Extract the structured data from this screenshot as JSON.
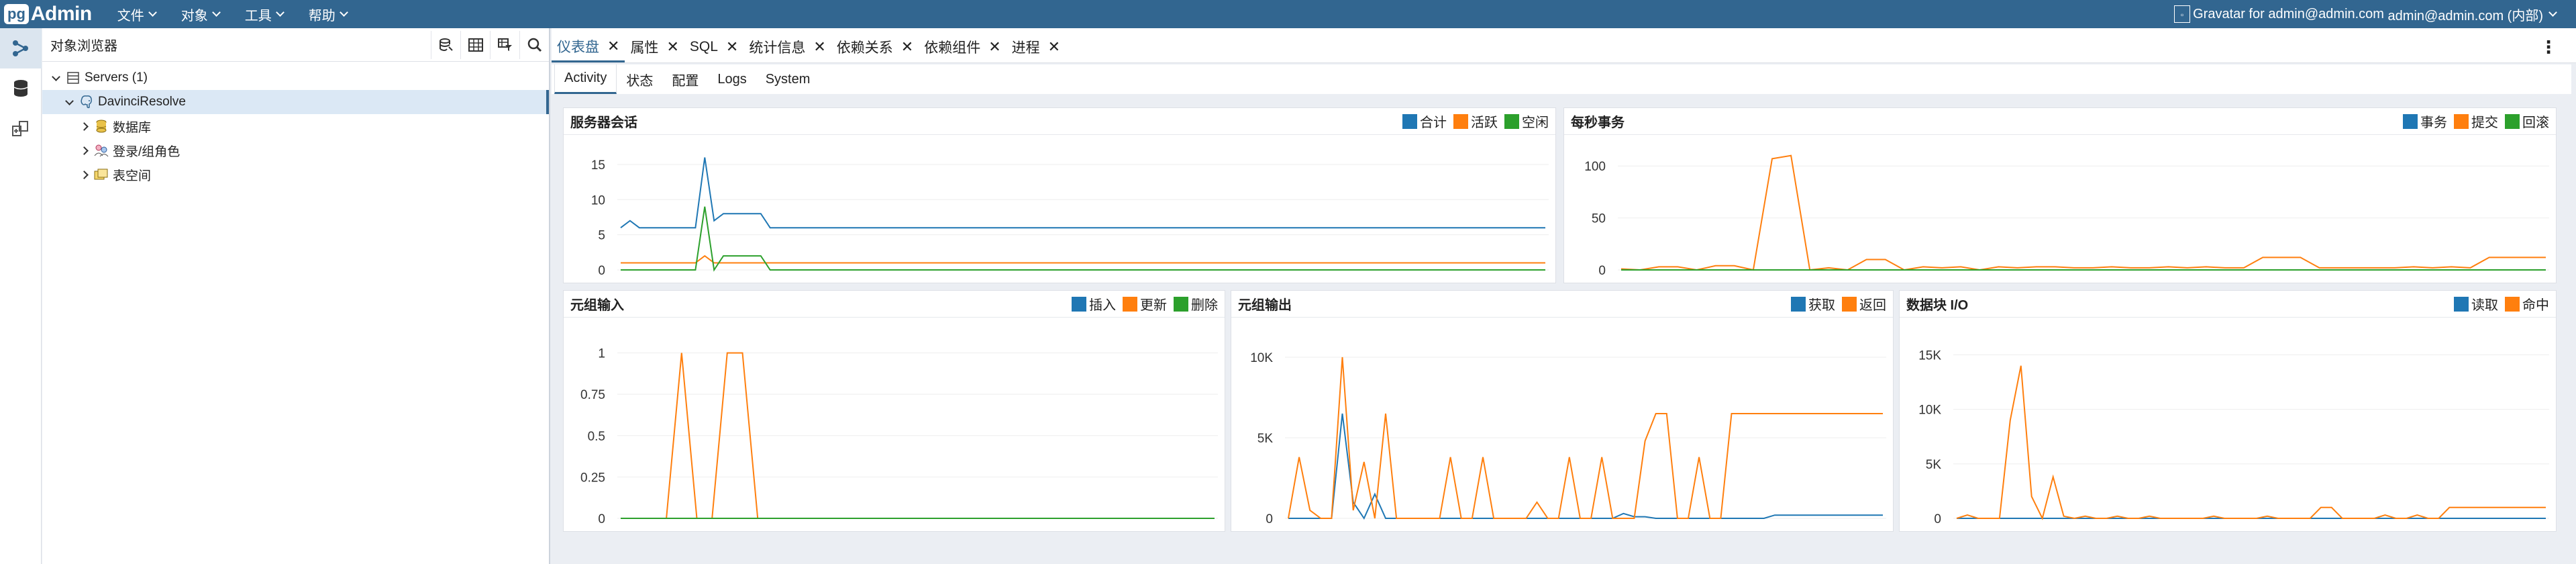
{
  "app": {
    "logo_pg": "pg",
    "logo_admin": "Admin"
  },
  "menu": [
    "文件",
    "对象",
    "工具",
    "帮助"
  ],
  "user": {
    "avatar_alt": "Gravatar for admin@admin.com",
    "label": "admin@admin.com (内部)"
  },
  "browser": {
    "title": "对象浏览器",
    "tree": [
      {
        "label": "Servers (1)",
        "level": 0,
        "expanded": true
      },
      {
        "label": "DavinciResolve",
        "level": 1,
        "expanded": true
      },
      {
        "label": "数据库",
        "level": 2
      },
      {
        "label": "登录/组角色",
        "level": 2
      },
      {
        "label": "表空间",
        "level": 2
      }
    ]
  },
  "tabs": [
    "仪表盘",
    "属性",
    "SQL",
    "统计信息",
    "依赖关系",
    "依赖组件",
    "进程"
  ],
  "subtabs": [
    "Activity",
    "状态",
    "配置",
    "Logs",
    "System"
  ],
  "colors": {
    "blue": "#1f77b4",
    "orange": "#ff7f0e",
    "green": "#2ca02c",
    "brand": "#326690"
  },
  "chart_data": [
    {
      "type": "line",
      "title": "服务器会话",
      "yticks": [
        "0",
        "5",
        "10",
        "15"
      ],
      "ylim": [
        0,
        17
      ],
      "series": [
        {
          "name": "合计",
          "color": "#1f77b4",
          "values": [
            6,
            7,
            6,
            6,
            6,
            6,
            6,
            6,
            6,
            16,
            7,
            8,
            8,
            8,
            8,
            8,
            6,
            6,
            6,
            6,
            6,
            6,
            6,
            6,
            6,
            6,
            6,
            6,
            6,
            6,
            6,
            6,
            6,
            6,
            6,
            6,
            6,
            6,
            6,
            6,
            6,
            6,
            6,
            6,
            6,
            6,
            6,
            6,
            6,
            6,
            6,
            6,
            6,
            6,
            6,
            6,
            6,
            6,
            6,
            6,
            6,
            6,
            6,
            6,
            6,
            6,
            6,
            6,
            6,
            6,
            6,
            6,
            6,
            6,
            6,
            6,
            6,
            6,
            6,
            6,
            6,
            6,
            6,
            6,
            6,
            6,
            6,
            6,
            6,
            6,
            6,
            6,
            6,
            6,
            6,
            6,
            6,
            6,
            6,
            6
          ]
        },
        {
          "name": "活跃",
          "color": "#ff7f0e",
          "values": [
            1,
            1,
            1,
            1,
            1,
            1,
            1,
            1,
            1,
            2,
            1,
            1,
            1,
            1,
            1,
            1,
            1,
            1,
            1,
            1,
            1,
            1,
            1,
            1,
            1,
            1,
            1,
            1,
            1,
            1,
            1,
            1,
            1,
            1,
            1,
            1,
            1,
            1,
            1,
            1,
            1,
            1,
            1,
            1,
            1,
            1,
            1,
            1,
            1,
            1,
            1,
            1,
            1,
            1,
            1,
            1,
            1,
            1,
            1,
            1,
            1,
            1,
            1,
            1,
            1,
            1,
            1,
            1,
            1,
            1,
            1,
            1,
            1,
            1,
            1,
            1,
            1,
            1,
            1,
            1,
            1,
            1,
            1,
            1,
            1,
            1,
            1,
            1,
            1,
            1,
            1,
            1,
            1,
            1,
            1,
            1,
            1,
            1,
            1,
            1
          ]
        },
        {
          "name": "空闲",
          "color": "#2ca02c",
          "values": [
            0,
            0,
            0,
            0,
            0,
            0,
            0,
            0,
            0,
            9,
            0,
            2,
            2,
            2,
            2,
            2,
            0,
            0,
            0,
            0,
            0,
            0,
            0,
            0,
            0,
            0,
            0,
            0,
            0,
            0,
            0,
            0,
            0,
            0,
            0,
            0,
            0,
            0,
            0,
            0,
            0,
            0,
            0,
            0,
            0,
            0,
            0,
            0,
            0,
            0,
            0,
            0,
            0,
            0,
            0,
            0,
            0,
            0,
            0,
            0,
            0,
            0,
            0,
            0,
            0,
            0,
            0,
            0,
            0,
            0,
            0,
            0,
            0,
            0,
            0,
            0,
            0,
            0,
            0,
            0,
            0,
            0,
            0,
            0,
            0,
            0,
            0,
            0,
            0,
            0,
            0,
            0,
            0,
            0,
            0,
            0,
            0,
            0,
            0,
            0
          ]
        }
      ]
    },
    {
      "type": "line",
      "title": "每秒事务",
      "yticks": [
        "0",
        "50",
        "100"
      ],
      "ylim": [
        0,
        115
      ],
      "series": [
        {
          "name": "事务",
          "color": "#1f77b4",
          "values": [
            0,
            0,
            0,
            0,
            0,
            0,
            0,
            0,
            0,
            0,
            0,
            0,
            0,
            0,
            0,
            0,
            0,
            0,
            0,
            0,
            0,
            0,
            0,
            0,
            0,
            0,
            0,
            0,
            0,
            0,
            0,
            0,
            0,
            0,
            0,
            0,
            0,
            0,
            0,
            0,
            0,
            0,
            0,
            0,
            0,
            0,
            0,
            0,
            0,
            0
          ]
        },
        {
          "name": "提交",
          "color": "#ff7f0e",
          "values": [
            1,
            0,
            3,
            3,
            0,
            4,
            4,
            0,
            107,
            110,
            0,
            2,
            0,
            10,
            10,
            0,
            3,
            2,
            3,
            0,
            3,
            2,
            3,
            3,
            2,
            2,
            3,
            2,
            2,
            3,
            2,
            3,
            2,
            2,
            12,
            12,
            12,
            2,
            2,
            2,
            2,
            2,
            3,
            2,
            3,
            2,
            12,
            12,
            12,
            12
          ]
        },
        {
          "name": "回滚",
          "color": "#2ca02c",
          "values": [
            0,
            0,
            0,
            0,
            0,
            0,
            0,
            0,
            0,
            0,
            0,
            0,
            0,
            0,
            0,
            0,
            0,
            0,
            0,
            0,
            0,
            0,
            0,
            0,
            0,
            0,
            0,
            0,
            0,
            0,
            0,
            0,
            0,
            0,
            0,
            0,
            0,
            0,
            0,
            0,
            0,
            0,
            0,
            0,
            0,
            0,
            0,
            0,
            0,
            0
          ]
        }
      ]
    },
    {
      "type": "line",
      "title": "元组输入",
      "yticks": [
        "0",
        "0.25",
        "0.5",
        "0.75",
        "1"
      ],
      "ylim": [
        0,
        1.12
      ],
      "series": [
        {
          "name": "插入",
          "color": "#1f77b4",
          "values": [
            0,
            0,
            0,
            0,
            0,
            0,
            0,
            0,
            0,
            0,
            0,
            0,
            0,
            0,
            0,
            0,
            0,
            0,
            0,
            0,
            0,
            0,
            0,
            0,
            0,
            0,
            0,
            0,
            0,
            0,
            0,
            0,
            0,
            0,
            0,
            0,
            0,
            0,
            0,
            0
          ]
        },
        {
          "name": "更新",
          "color": "#ff7f0e",
          "values": [
            0,
            0,
            0,
            0,
            1,
            0,
            0,
            1,
            1,
            0,
            0,
            0,
            0,
            0,
            0,
            0,
            0,
            0,
            0,
            0,
            0,
            0,
            0,
            0,
            0,
            0,
            0,
            0,
            0,
            0,
            0,
            0,
            0,
            0,
            0,
            0,
            0,
            0,
            0,
            0
          ]
        },
        {
          "name": "删除",
          "color": "#2ca02c",
          "values": [
            0,
            0,
            0,
            0,
            0,
            0,
            0,
            0,
            0,
            0,
            0,
            0,
            0,
            0,
            0,
            0,
            0,
            0,
            0,
            0,
            0,
            0,
            0,
            0,
            0,
            0,
            0,
            0,
            0,
            0,
            0,
            0,
            0,
            0,
            0,
            0,
            0,
            0,
            0,
            0
          ]
        }
      ]
    },
    {
      "type": "line",
      "title": "元组输出",
      "yticks": [
        "0",
        "5K",
        "10K"
      ],
      "ylim": [
        0,
        11500
      ],
      "series": [
        {
          "name": "获取",
          "color": "#1f77b4",
          "values": [
            0,
            0,
            0,
            0,
            0,
            6500,
            1000,
            0,
            1500,
            0,
            0,
            0,
            0,
            0,
            0,
            0,
            0,
            0,
            0,
            0,
            0,
            0,
            0,
            0,
            0,
            0,
            0,
            0,
            0,
            0,
            0,
            300,
            100,
            100,
            0,
            0,
            0,
            0,
            0,
            0,
            0,
            0,
            0,
            0,
            0,
            200,
            200,
            200,
            200,
            200,
            200,
            200,
            200,
            200,
            200,
            200
          ]
        },
        {
          "name": "返回",
          "color": "#ff7f0e",
          "values": [
            0,
            3800,
            500,
            0,
            0,
            10000,
            500,
            3500,
            0,
            6500,
            0,
            0,
            0,
            0,
            0,
            3800,
            0,
            0,
            3800,
            0,
            0,
            0,
            0,
            1000,
            0,
            0,
            3800,
            0,
            0,
            3800,
            0,
            0,
            0,
            4800,
            6500,
            6500,
            0,
            0,
            3800,
            0,
            0,
            6500,
            6500,
            6500,
            6500,
            6500,
            6500,
            6500,
            6500,
            6500,
            6500,
            6500,
            6500,
            6500,
            6500,
            6500
          ]
        }
      ]
    },
    {
      "type": "line",
      "title": "数据块 I/O",
      "yticks": [
        "0",
        "5K",
        "10K",
        "15K"
      ],
      "ylim": [
        0,
        17000
      ],
      "series": [
        {
          "name": "读取",
          "color": "#1f77b4",
          "values": [
            0,
            0,
            0,
            0,
            0,
            0,
            0,
            0,
            0,
            0,
            0,
            0,
            0,
            0,
            0,
            0,
            0,
            0,
            0,
            0,
            0,
            0,
            0,
            0,
            0,
            0,
            0,
            0,
            0,
            0,
            0,
            0,
            0,
            0,
            0,
            0,
            0,
            0,
            0,
            0,
            0,
            0,
            0,
            0,
            0,
            0,
            0,
            0,
            0,
            0,
            0,
            0,
            0,
            0,
            0,
            0
          ]
        },
        {
          "name": "命中",
          "color": "#ff7f0e",
          "values": [
            0,
            300,
            0,
            0,
            0,
            9000,
            14000,
            2000,
            0,
            3800,
            200,
            0,
            200,
            0,
            0,
            200,
            0,
            0,
            200,
            0,
            0,
            0,
            0,
            0,
            200,
            0,
            0,
            0,
            0,
            200,
            0,
            0,
            0,
            0,
            1000,
            1000,
            0,
            0,
            0,
            0,
            300,
            0,
            0,
            300,
            0,
            0,
            1000,
            1000,
            1000,
            1000,
            1000,
            1000,
            1000,
            1000,
            1000,
            1000
          ]
        }
      ]
    }
  ]
}
